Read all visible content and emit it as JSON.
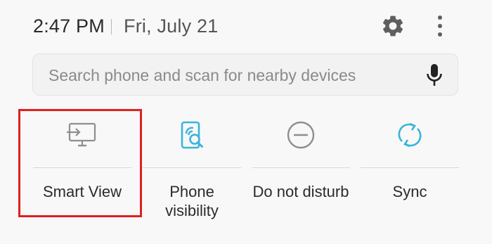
{
  "status": {
    "time": "2:47 PM",
    "date": "Fri, July 21"
  },
  "header_icons": {
    "settings": "gear-icon",
    "more": "more-vertical-icon"
  },
  "search": {
    "placeholder": "Search phone and scan for nearby devices",
    "value": "",
    "mic_icon": "microphone-icon"
  },
  "tiles": [
    {
      "label": "Smart View",
      "icon": "smart-view-icon",
      "state": "off",
      "highlighted": true
    },
    {
      "label": "Phone visibility",
      "icon": "phone-visibility-icon",
      "state": "on"
    },
    {
      "label": "Do not disturb",
      "icon": "do-not-disturb-icon",
      "state": "off"
    },
    {
      "label": "Sync",
      "icon": "sync-icon",
      "state": "on"
    }
  ],
  "colors": {
    "background": "#f8f8f8",
    "active_icon": "#39b4dc",
    "inactive_icon": "#8e8e8e",
    "highlight_border": "#e02020"
  }
}
